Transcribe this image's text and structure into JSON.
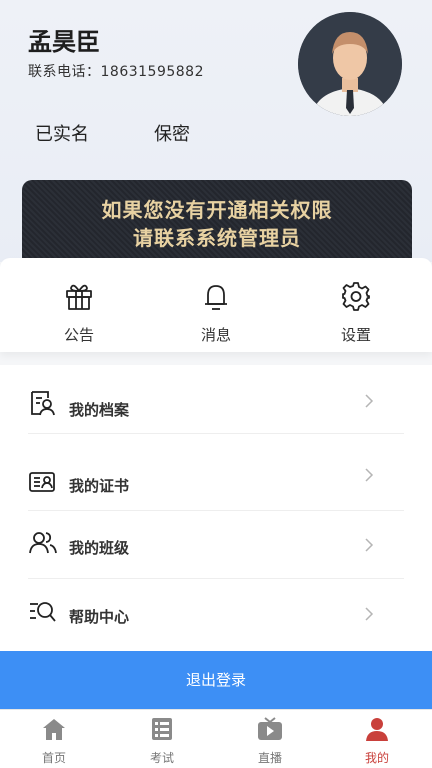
{
  "profile": {
    "name": "孟昊臣",
    "phone": "联系电话：18631595882",
    "verified": "已实名",
    "privacy": "保密"
  },
  "banner": {
    "line1": "如果您没有开通相关权限",
    "line2": "请联系系统管理员"
  },
  "quick_actions": [
    {
      "label": "公告",
      "icon": "gift-icon"
    },
    {
      "label": "消息",
      "icon": "bell-icon"
    },
    {
      "label": "设置",
      "icon": "gear-icon"
    }
  ],
  "menu": [
    {
      "label": "我的档案",
      "icon": "profile-file-icon"
    },
    {
      "label": "我的证书",
      "icon": "certificate-icon"
    },
    {
      "label": "我的班级",
      "icon": "group-icon"
    },
    {
      "label": "帮助中心",
      "icon": "help-search-icon"
    }
  ],
  "logout_label": "退出登录",
  "tabs": [
    {
      "label": "首页",
      "icon": "home-icon"
    },
    {
      "label": "考试",
      "icon": "exam-icon"
    },
    {
      "label": "直播",
      "icon": "tv-play-icon"
    },
    {
      "label": "我的",
      "icon": "person-icon"
    }
  ],
  "colors": {
    "accent": "#3d8ff5",
    "active_tab": "#c9403b",
    "banner_text": "#e8d2a2"
  }
}
